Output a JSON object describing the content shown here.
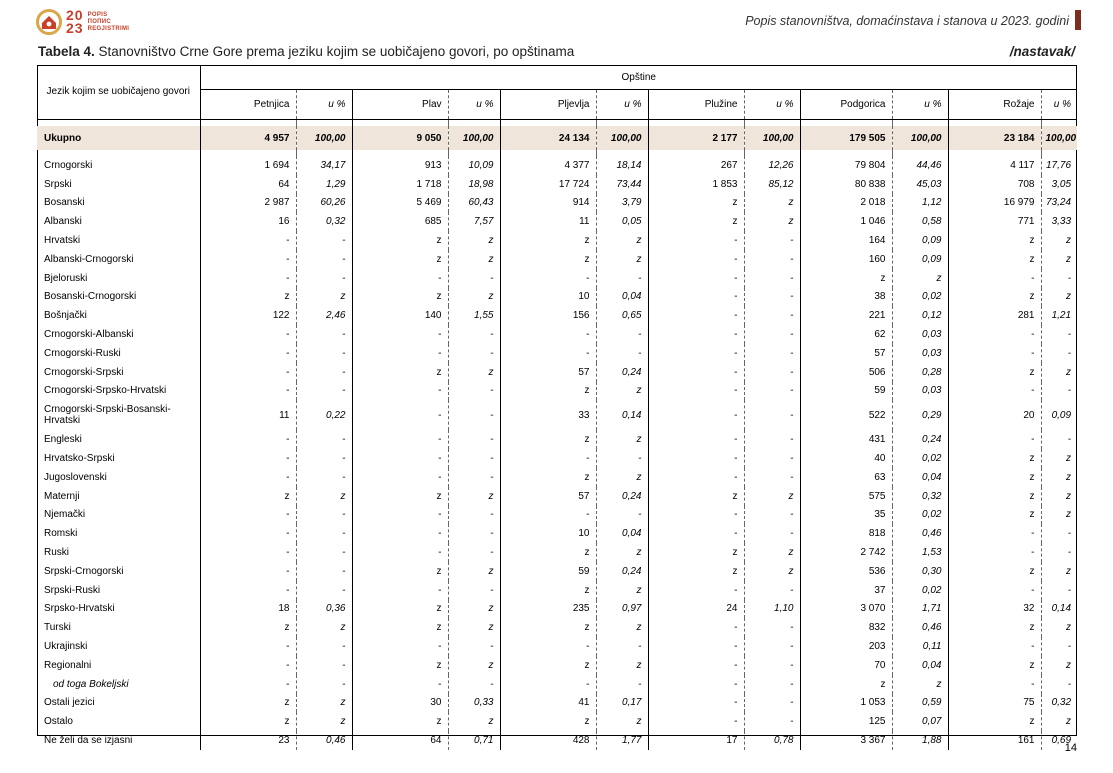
{
  "logo": {
    "year_top": "20",
    "year_bottom": "23",
    "words": [
      "POPIS",
      "ПОПИС",
      "REGJISTRIMI"
    ]
  },
  "header": {
    "title": "Popis stanovništva, domaćinstava i stanova u 2023. godini"
  },
  "caption": {
    "label": "Tabela 4.",
    "text": " Stanovništvo Crne Gore prema jeziku kojim se uobičajeno govori, po opštinama",
    "continued": "/nastavak/"
  },
  "table": {
    "row_header": "Jezik kojim se uobičajeno govori",
    "group_header": "Opštine",
    "municipalities": [
      "Petnjica",
      "Plav",
      "Pljevlja",
      "Plužine",
      "Podgorica",
      "Rožaje"
    ],
    "pct_label": "u %",
    "total": {
      "label": "Ukupno",
      "values": [
        "4 957",
        "100,00",
        "9 050",
        "100,00",
        "24 134",
        "100,00",
        "2 177",
        "100,00",
        "179 505",
        "100,00",
        "23 184",
        "100,00"
      ]
    },
    "rows": [
      {
        "label": "Crnogorski",
        "values": [
          "1 694",
          "34,17",
          "913",
          "10,09",
          "4 377",
          "18,14",
          "267",
          "12,26",
          "79 804",
          "44,46",
          "4 117",
          "17,76"
        ]
      },
      {
        "label": "Srpski",
        "values": [
          "64",
          "1,29",
          "1 718",
          "18,98",
          "17 724",
          "73,44",
          "1 853",
          "85,12",
          "80 838",
          "45,03",
          "708",
          "3,05"
        ]
      },
      {
        "label": "Bosanski",
        "values": [
          "2 987",
          "60,26",
          "5 469",
          "60,43",
          "914",
          "3,79",
          "z",
          "z",
          "2 018",
          "1,12",
          "16 979",
          "73,24"
        ]
      },
      {
        "label": "Albanski",
        "values": [
          "16",
          "0,32",
          "685",
          "7,57",
          "11",
          "0,05",
          "z",
          "z",
          "1 046",
          "0,58",
          "771",
          "3,33"
        ]
      },
      {
        "label": "Hrvatski",
        "values": [
          "-",
          "-",
          "z",
          "z",
          "z",
          "z",
          "-",
          "-",
          "164",
          "0,09",
          "z",
          "z"
        ]
      },
      {
        "label": "Albanski-Crnogorski",
        "values": [
          "-",
          "-",
          "z",
          "z",
          "z",
          "z",
          "-",
          "-",
          "160",
          "0,09",
          "z",
          "z"
        ]
      },
      {
        "label": "Bjeloruski",
        "values": [
          "-",
          "-",
          "-",
          "-",
          "-",
          "-",
          "-",
          "-",
          "z",
          "z",
          "-",
          "-"
        ]
      },
      {
        "label": "Bosanski-Crnogorski",
        "values": [
          "z",
          "z",
          "z",
          "z",
          "10",
          "0,04",
          "-",
          "-",
          "38",
          "0,02",
          "z",
          "z"
        ]
      },
      {
        "label": "Bošnjački",
        "values": [
          "122",
          "2,46",
          "140",
          "1,55",
          "156",
          "0,65",
          "-",
          "-",
          "221",
          "0,12",
          "281",
          "1,21"
        ]
      },
      {
        "label": "Crnogorski-Albanski",
        "values": [
          "-",
          "-",
          "-",
          "-",
          "-",
          "-",
          "-",
          "-",
          "62",
          "0,03",
          "-",
          "-"
        ]
      },
      {
        "label": "Crnogorski-Ruski",
        "values": [
          "-",
          "-",
          "-",
          "-",
          "-",
          "-",
          "-",
          "-",
          "57",
          "0,03",
          "-",
          "-"
        ]
      },
      {
        "label": "Crnogorski-Srpski",
        "values": [
          "-",
          "-",
          "z",
          "z",
          "57",
          "0,24",
          "-",
          "-",
          "506",
          "0,28",
          "z",
          "z"
        ]
      },
      {
        "label": "Crnogorski-Srpsko-Hrvatski",
        "values": [
          "-",
          "-",
          "-",
          "-",
          "z",
          "z",
          "-",
          "-",
          "59",
          "0,03",
          "-",
          "-"
        ]
      },
      {
        "label": "Crnogorski-Srpski-Bosanski-Hrvatski",
        "tall": true,
        "values": [
          "11",
          "0,22",
          "-",
          "-",
          "33",
          "0,14",
          "-",
          "-",
          "522",
          "0,29",
          "20",
          "0,09"
        ]
      },
      {
        "label": "Engleski",
        "values": [
          "-",
          "-",
          "-",
          "-",
          "z",
          "z",
          "-",
          "-",
          "431",
          "0,24",
          "-",
          "-"
        ]
      },
      {
        "label": "Hrvatsko-Srpski",
        "values": [
          "-",
          "-",
          "-",
          "-",
          "-",
          "-",
          "-",
          "-",
          "40",
          "0,02",
          "z",
          "z"
        ]
      },
      {
        "label": "Jugoslovenski",
        "values": [
          "-",
          "-",
          "-",
          "-",
          "z",
          "z",
          "-",
          "-",
          "63",
          "0,04",
          "z",
          "z"
        ]
      },
      {
        "label": "Maternji",
        "values": [
          "z",
          "z",
          "z",
          "z",
          "57",
          "0,24",
          "z",
          "z",
          "575",
          "0,32",
          "z",
          "z"
        ]
      },
      {
        "label": "Njemački",
        "values": [
          "-",
          "-",
          "-",
          "-",
          "-",
          "-",
          "-",
          "-",
          "35",
          "0,02",
          "z",
          "z"
        ]
      },
      {
        "label": "Romski",
        "values": [
          "-",
          "-",
          "-",
          "-",
          "10",
          "0,04",
          "-",
          "-",
          "818",
          "0,46",
          "-",
          "-"
        ]
      },
      {
        "label": "Ruski",
        "values": [
          "-",
          "-",
          "-",
          "-",
          "z",
          "z",
          "z",
          "z",
          "2 742",
          "1,53",
          "-",
          "-"
        ]
      },
      {
        "label": "Srpski-Crnogorski",
        "values": [
          "-",
          "-",
          "z",
          "z",
          "59",
          "0,24",
          "z",
          "z",
          "536",
          "0,30",
          "z",
          "z"
        ]
      },
      {
        "label": "Srpski-Ruski",
        "values": [
          "-",
          "-",
          "-",
          "-",
          "z",
          "z",
          "-",
          "-",
          "37",
          "0,02",
          "-",
          "-"
        ]
      },
      {
        "label": "Srpsko-Hrvatski",
        "values": [
          "18",
          "0,36",
          "z",
          "z",
          "235",
          "0,97",
          "24",
          "1,10",
          "3 070",
          "1,71",
          "32",
          "0,14"
        ]
      },
      {
        "label": "Turski",
        "values": [
          "z",
          "z",
          "z",
          "z",
          "z",
          "z",
          "-",
          "-",
          "832",
          "0,46",
          "z",
          "z"
        ]
      },
      {
        "label": "Ukrajinski",
        "values": [
          "-",
          "-",
          "-",
          "-",
          "-",
          "-",
          "-",
          "-",
          "203",
          "0,11",
          "-",
          "-"
        ]
      },
      {
        "label": "Regionalni",
        "values": [
          "-",
          "-",
          "z",
          "z",
          "z",
          "z",
          "-",
          "-",
          "70",
          "0,04",
          "z",
          "z"
        ]
      },
      {
        "label": "od toga Bokeljski",
        "indent": true,
        "values": [
          "-",
          "-",
          "-",
          "-",
          "-",
          "-",
          "-",
          "-",
          "z",
          "z",
          "-",
          "-"
        ]
      },
      {
        "label": "Ostali jezici",
        "values": [
          "z",
          "z",
          "30",
          "0,33",
          "41",
          "0,17",
          "-",
          "-",
          "1 053",
          "0,59",
          "75",
          "0,32"
        ]
      },
      {
        "label": "Ostalo",
        "values": [
          "z",
          "z",
          "z",
          "z",
          "z",
          "z",
          "-",
          "-",
          "125",
          "0,07",
          "z",
          "z"
        ]
      },
      {
        "label": "Ne želi da se izjasni",
        "values": [
          "23",
          "0,46",
          "64",
          "0,71",
          "428",
          "1,77",
          "17",
          "0,78",
          "3 367",
          "1,88",
          "161",
          "0,69"
        ]
      }
    ]
  },
  "footer": {
    "page_number": "14"
  }
}
